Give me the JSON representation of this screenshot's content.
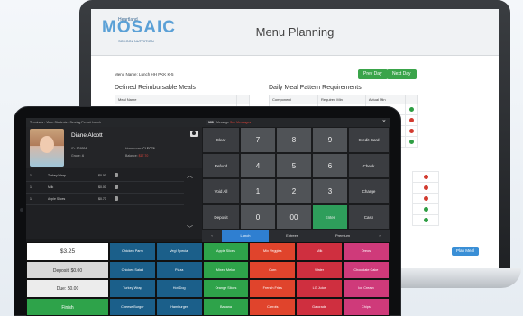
{
  "laptop": {
    "logo": {
      "pre": "Heartland",
      "main": "MOSAIC",
      "sub": "SCHOOL NUTRITION"
    },
    "title": "Menu Planning",
    "menu_name": "Menu Name:  Lunch HH PKK K-5",
    "buttons": {
      "prev_day": "Prev Day",
      "next_day": "Next Day",
      "plan": "Plan Meal"
    },
    "meals": {
      "title": "Defined Reimbursable Meals",
      "header": "Meal Name",
      "rows": [
        "Chicken Sandwich Meal"
      ]
    },
    "pattern": {
      "title": "Daily Meal Pattern Requirements",
      "headers": [
        "Component",
        "Required Min",
        "Actual Min"
      ],
      "rows": [
        {
          "component": "Meat/Meat Alt",
          "required": "8.000 oz eq",
          "actual": "8.000",
          "status": "ok"
        },
        {
          "component": "",
          "required": "",
          "actual": "",
          "status": "bad"
        },
        {
          "component": "",
          "required": "",
          "actual": "",
          "status": "bad"
        },
        {
          "component": "",
          "required": "",
          "actual": "",
          "status": "ok"
        }
      ],
      "lower_status": [
        "bad",
        "bad",
        "bad",
        "ok",
        "ok"
      ]
    }
  },
  "tablet": {
    "topbar": {
      "breadcrumb": "Terminals  ›  View: Students  ›  Serving Period: Lunch",
      "message_badge": "100",
      "message_label": "Message",
      "message_alert": "See Messages",
      "close": "×"
    },
    "student": {
      "name": "Diane Alcott",
      "id_label": "ID:",
      "id": "101004",
      "grade_label": "Grade:",
      "grade": "4",
      "homeroom_label": "Homeroom:",
      "homeroom": "CLEO76",
      "balance_label": "Balance:",
      "balance": "$17.70"
    },
    "items": [
      {
        "n": "1",
        "name": "Turkey Wrap",
        "price": "$0.00"
      },
      {
        "n": "1",
        "name": "Milk",
        "price": "$0.00"
      },
      {
        "n": "1",
        "name": "Apple Slices",
        "price": "$0.73"
      }
    ],
    "keypad": {
      "rows": [
        [
          "Clear",
          "7",
          "8",
          "9",
          "Credit Card"
        ],
        [
          "Refund",
          "4",
          "5",
          "6",
          "Check"
        ],
        [
          "Void All",
          "1",
          "2",
          "3",
          "Charge"
        ],
        [
          "Deposit",
          "0",
          "00",
          "Enter",
          "Cash"
        ]
      ]
    },
    "categories": [
      "‹",
      "Lunch",
      "Entrees",
      "Premium",
      "›"
    ],
    "totals": {
      "total": "$3.25",
      "deposit": "Deposit: $0.00",
      "due": "Due: $0.00",
      "finish": "Finish"
    },
    "tiles": [
      [
        {
          "label": "Chicken Parm",
          "color": "#1b5f8a"
        },
        {
          "label": "Vegi Special",
          "color": "#1b5f8a"
        },
        {
          "label": "Apple Slices",
          "color": "#2ea34a"
        },
        {
          "label": "Mix Veggies",
          "color": "#e0442c"
        },
        {
          "label": "Milk",
          "color": "#cf2f3f"
        },
        {
          "label": "Oreos",
          "color": "#cf3a7a"
        }
      ],
      [
        {
          "label": "Chicken Salad",
          "color": "#1b5f8a"
        },
        {
          "label": "Pizza",
          "color": "#1b5f8a"
        },
        {
          "label": "Mixed Melon",
          "color": "#2ea34a"
        },
        {
          "label": "Corn",
          "color": "#e0442c"
        },
        {
          "label": "Water",
          "color": "#cf2f3f"
        },
        {
          "label": "Chocolate Cake",
          "color": "#cf3a7a"
        }
      ],
      [
        {
          "label": "Turkey Wrap",
          "color": "#1b5f8a"
        },
        {
          "label": "Hot Dog",
          "color": "#1b5f8a"
        },
        {
          "label": "Orange Slices",
          "color": "#2ea34a"
        },
        {
          "label": "French Fries",
          "color": "#e0442c"
        },
        {
          "label": "LG Juice",
          "color": "#cf2f3f"
        },
        {
          "label": "Ice Cream",
          "color": "#cf3a7a"
        }
      ],
      [
        {
          "label": "Cheese Burger",
          "color": "#1b5f8a"
        },
        {
          "label": "Hamburger",
          "color": "#1b5f8a"
        },
        {
          "label": "Banana",
          "color": "#2ea34a"
        },
        {
          "label": "Carrots",
          "color": "#e0442c"
        },
        {
          "label": "Gatorade",
          "color": "#cf2f3f"
        },
        {
          "label": "Chips",
          "color": "#cf3a7a"
        }
      ]
    ],
    "colors": {
      "total_bg": "#ffffff",
      "deposit_bg": "#d8d8d8",
      "due_bg": "#ececec",
      "finish_bg": "#2ea34a",
      "accent": "#2f7fd1"
    }
  }
}
